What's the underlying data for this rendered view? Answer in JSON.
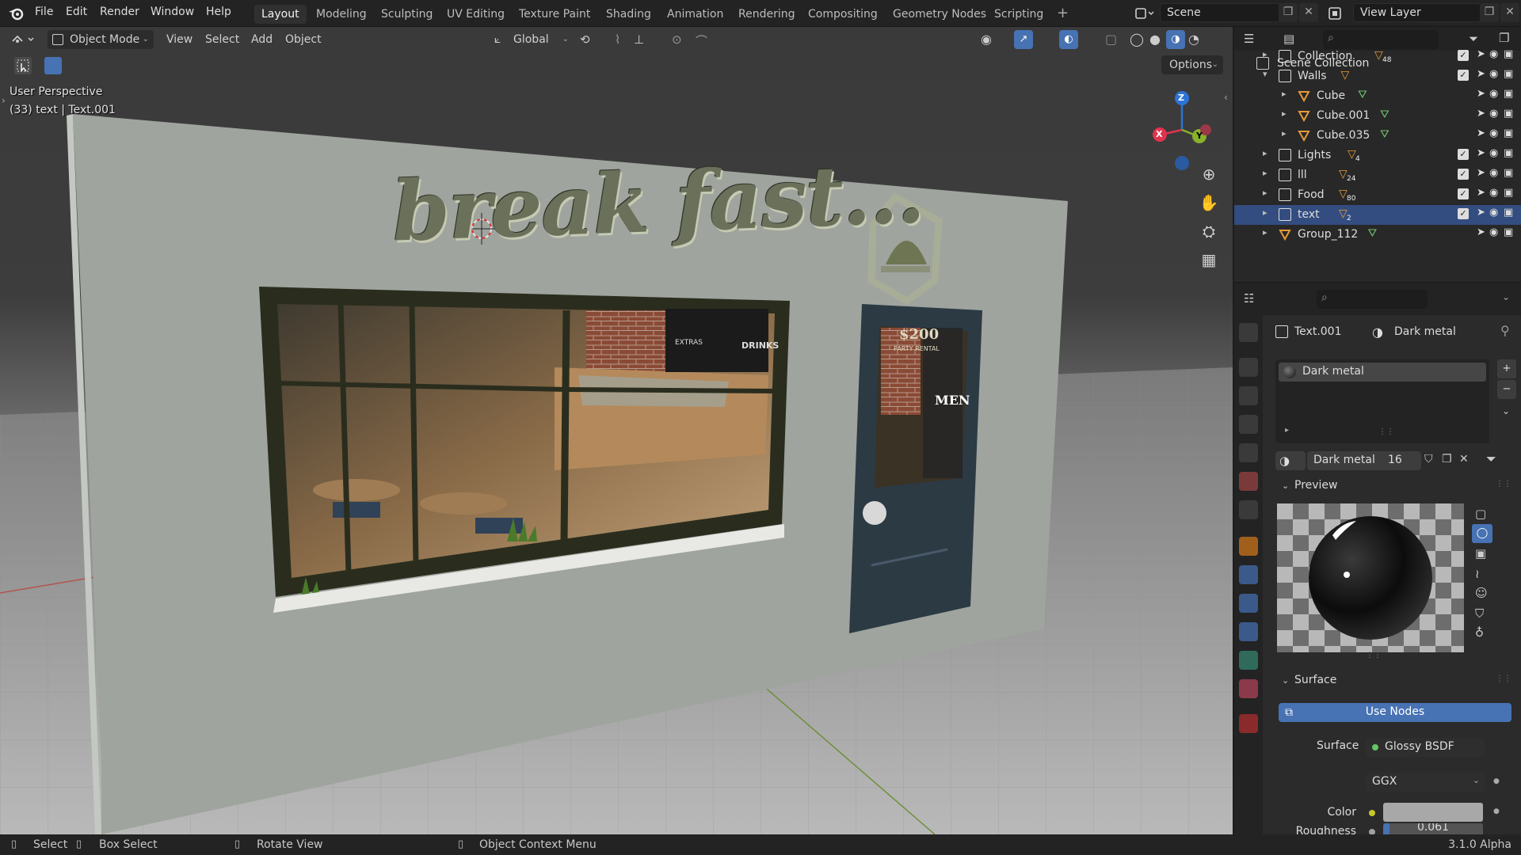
{
  "menus": [
    "File",
    "Edit",
    "Render",
    "Window",
    "Help"
  ],
  "workspaces": [
    "Layout",
    "Modeling",
    "Sculpting",
    "UV Editing",
    "Texture Paint",
    "Shading",
    "Animation",
    "Rendering",
    "Compositing",
    "Geometry Nodes",
    "Scripting"
  ],
  "active_workspace": "Layout",
  "scene": "Scene",
  "view_layer": "View Layer",
  "viewport": {
    "mode": "Object Mode",
    "menus": [
      "View",
      "Select",
      "Add",
      "Object"
    ],
    "transform": "Global",
    "info_line1": "User Perspective",
    "info_line2": "(33) text | Text.001",
    "options": "Options",
    "sign_text": "break fast...",
    "poster_price": "$200",
    "poster_text": "PARTY RENTAL",
    "board_labels": [
      "EXTRAS",
      "DRINKS"
    ],
    "door_sign": "MEN",
    "axis_labels": [
      "Z",
      "X",
      "Y"
    ]
  },
  "outliner": {
    "root": "Scene Collection",
    "items": [
      {
        "label": "Collection",
        "badge": "48"
      },
      {
        "label": "Walls",
        "badge": ""
      },
      {
        "label": "Cube",
        "badge": ""
      },
      {
        "label": "Cube.001",
        "badge": ""
      },
      {
        "label": "Cube.035",
        "badge": ""
      },
      {
        "label": "Lights",
        "badge": "4"
      },
      {
        "label": "lll",
        "badge": "24"
      },
      {
        "label": "Food",
        "badge": "80"
      },
      {
        "label": "text",
        "badge": "2"
      },
      {
        "label": "Group_112",
        "badge": ""
      }
    ]
  },
  "properties": {
    "object_name": "Text.001",
    "material_name": "Dark metal",
    "slot_name": "Dark metal",
    "material_users": "16",
    "preview_label": "Preview",
    "surface_label": "Surface",
    "use_nodes": "Use Nodes",
    "surface_field_label": "Surface",
    "surface_shader": "Glossy BSDF",
    "distribution": "GGX",
    "color_label": "Color",
    "roughness_label": "Roughness",
    "roughness_value": "0.061"
  },
  "statusbar": {
    "select": "Select",
    "box_select": "Box Select",
    "rotate_view": "Rotate View",
    "context_menu": "Object Context Menu",
    "version": "3.1.0 Alpha"
  },
  "colors": {
    "accent_blue": "#4772b3",
    "selection_blue": "#334d80",
    "axis_x": "#e0334f",
    "axis_y": "#89b12b",
    "axis_z": "#2c73d6"
  }
}
